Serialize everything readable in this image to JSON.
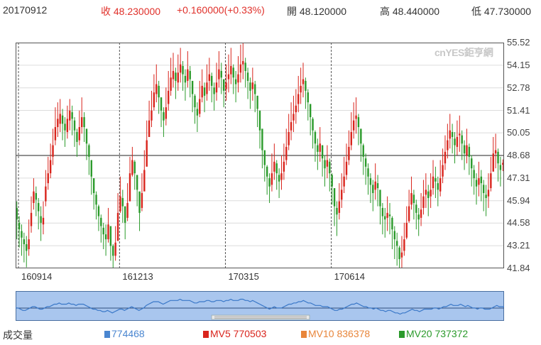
{
  "header": {
    "date": "20170912",
    "close": "收 48.230000",
    "change": "+0.160000(+0.33%)",
    "open": "開 48.120000",
    "high": "高 48.440000",
    "low": "低 47.730000"
  },
  "watermark": "cnYES鉅亨網",
  "volume_row": {
    "label": "成交量",
    "vol": "774468",
    "mv5": "MV5 770503",
    "mv10": "MV10 836378",
    "mv20": "MV20 737372"
  },
  "colors": {
    "up": "#d9241c",
    "down": "#2a9a2a",
    "accent": "#4a86d0"
  },
  "chart_data": {
    "type": "candlestick",
    "y_ticks": [
      "55.52",
      "54.15",
      "52.78",
      "51.41",
      "50.05",
      "48.68",
      "47.31",
      "45.94",
      "44.58",
      "43.21",
      "41.84"
    ],
    "ylim": [
      41.84,
      55.52
    ],
    "x_ticks": [
      "160914",
      "161213",
      "170315",
      "170614"
    ],
    "current_price_line": 48.68,
    "grid": true,
    "series": [
      {
        "close": [
          44.8,
          44.2,
          43.7,
          43.3,
          42.9,
          43.6,
          45.2,
          46.5,
          46.0,
          45.3,
          44.6,
          44.9,
          46.8,
          47.6,
          48.4,
          49.3,
          50.4,
          50.9,
          51.2,
          50.6,
          50.2,
          50.9,
          51.4,
          50.9,
          50.2,
          49.5,
          50.4,
          51.0,
          50.4,
          49.4,
          48.6,
          47.4,
          46.4,
          45.7,
          45.0,
          44.4,
          43.9,
          43.6,
          44.5,
          43.2,
          42.6,
          43.4,
          45.2,
          46.2,
          45.6,
          44.6,
          45.8,
          47.6,
          48.4,
          47.6,
          46.6,
          45.2,
          46.4,
          47.8,
          49.6,
          50.8,
          51.4,
          52.5,
          53.0,
          52.2,
          51.4,
          50.8,
          51.6,
          52.6,
          53.4,
          53.8,
          53.2,
          53.7,
          54.2,
          53.6,
          53.1,
          53.9,
          53.3,
          52.4,
          51.6,
          51.1,
          52.1,
          52.9,
          52.3,
          53.1,
          53.6,
          52.9,
          52.4,
          53.1,
          53.9,
          53.4,
          52.6,
          53.1,
          53.6,
          54.1,
          53.4,
          53.0,
          53.6,
          54.2,
          54.4,
          53.8,
          53.2,
          52.6,
          53.1,
          52.4,
          51.5,
          50.2,
          49.0,
          48.1,
          47.4,
          46.8,
          47.6,
          48.3,
          47.6,
          47.1,
          47.6,
          48.3,
          49.2,
          50.1,
          50.7,
          51.2,
          51.7,
          52.4,
          52.9,
          53.3,
          52.6,
          51.9,
          51.0,
          50.2,
          49.4,
          48.9,
          49.4,
          48.5,
          47.9,
          48.4,
          47.6,
          46.8,
          45.6,
          45.1,
          45.9,
          46.6,
          47.4,
          48.3,
          49.2,
          50.1,
          50.8,
          51.1,
          50.4,
          49.4,
          48.6,
          48.0,
          47.4,
          46.9,
          46.4,
          47.1,
          46.7,
          45.6,
          45.0,
          44.8,
          45.2,
          45.0,
          44.2,
          43.6,
          43.2,
          42.4,
          42.8,
          43.6,
          44.6,
          45.6,
          46.4,
          45.8,
          45.2,
          44.8,
          45.4,
          46.2,
          46.6,
          46.1,
          46.6,
          47.4,
          47.1,
          46.6,
          47.3,
          48.1,
          48.9,
          49.6,
          50.2,
          49.8,
          49.3,
          49.8,
          50.0,
          49.4,
          48.8,
          49.3,
          48.6,
          47.9,
          47.3,
          46.8,
          47.3,
          47.0,
          46.4,
          46.1,
          46.6,
          47.6,
          48.8,
          49.0,
          48.2,
          47.8,
          48.23
        ],
        "high": [
          45.9,
          45.0,
          44.5,
          44.0,
          43.8,
          44.8,
          46.2,
          47.3,
          46.8,
          46.1,
          45.6,
          45.9,
          47.8,
          48.6,
          49.4,
          50.3,
          51.6,
          51.9,
          52.1,
          51.5,
          51.0,
          51.7,
          52.1,
          51.7,
          51.0,
          50.3,
          51.4,
          52.2,
          51.3,
          50.2,
          49.4,
          48.2,
          47.2,
          46.5,
          45.7,
          45.1,
          44.6,
          44.5,
          45.5,
          44.0,
          43.3,
          44.4,
          46.4,
          47.4,
          46.6,
          45.4,
          47.0,
          48.6,
          49.2,
          48.4,
          47.4,
          46.0,
          47.6,
          49.0,
          50.8,
          52.0,
          52.6,
          53.6,
          54.2,
          53.2,
          52.2,
          51.6,
          52.8,
          53.8,
          54.6,
          54.9,
          54.0,
          54.8,
          55.2,
          54.4,
          53.9,
          55.0,
          54.1,
          53.2,
          52.4,
          51.9,
          53.2,
          53.9,
          53.1,
          54.2,
          54.6,
          53.7,
          53.1,
          54.3,
          55.0,
          54.3,
          53.3,
          54.2,
          54.8,
          55.2,
          54.2,
          53.8,
          54.7,
          55.4,
          55.6,
          54.6,
          54.0,
          53.4,
          54.0,
          53.2,
          52.3,
          51.0,
          49.8,
          48.9,
          48.1,
          47.6,
          48.8,
          49.4,
          48.4,
          47.9,
          48.7,
          49.4,
          50.3,
          51.2,
          51.9,
          52.3,
          52.7,
          53.5,
          54.0,
          54.3,
          53.4,
          52.7,
          51.8,
          51.0,
          50.2,
          49.7,
          50.4,
          49.3,
          48.7,
          49.3,
          48.5,
          47.6,
          46.4,
          45.9,
          47.0,
          47.6,
          48.6,
          49.4,
          50.2,
          51.3,
          51.9,
          52.2,
          51.2,
          50.2,
          49.4,
          48.8,
          48.2,
          47.6,
          47.2,
          48.2,
          47.5,
          46.4,
          45.8,
          45.5,
          46.2,
          45.8,
          45.0,
          44.4,
          44.0,
          43.2,
          43.8,
          44.6,
          45.6,
          46.6,
          47.4,
          46.6,
          46.0,
          45.5,
          46.4,
          47.2,
          47.6,
          46.9,
          47.6,
          48.4,
          48.0,
          47.4,
          48.4,
          49.1,
          49.9,
          50.6,
          51.2,
          50.6,
          50.1,
          50.8,
          51.1,
          50.2,
          49.6,
          50.3,
          49.4,
          48.7,
          48.1,
          47.6,
          48.3,
          47.8,
          47.2,
          46.9,
          47.6,
          48.6,
          49.8,
          50.0,
          49.1,
          48.6,
          48.44
        ],
        "low": [
          43.6,
          43.1,
          42.6,
          42.2,
          41.9,
          42.6,
          44.0,
          45.4,
          45.0,
          44.2,
          43.5,
          43.9,
          45.6,
          46.6,
          47.3,
          48.1,
          49.3,
          49.8,
          50.1,
          49.6,
          49.2,
          49.7,
          50.2,
          49.9,
          49.2,
          48.6,
          49.3,
          50.0,
          49.5,
          48.4,
          47.5,
          46.3,
          45.4,
          44.8,
          44.1,
          43.4,
          43.0,
          42.6,
          43.4,
          42.3,
          41.6,
          42.3,
          44.2,
          45.2,
          44.6,
          43.6,
          44.7,
          46.5,
          47.4,
          46.6,
          45.6,
          44.1,
          45.3,
          46.8,
          48.5,
          49.8,
          50.4,
          51.4,
          51.9,
          51.2,
          50.4,
          49.8,
          50.5,
          51.4,
          52.3,
          52.8,
          52.1,
          52.6,
          53.1,
          52.6,
          52.0,
          52.8,
          52.2,
          51.3,
          50.6,
          50.1,
          51.0,
          51.9,
          51.3,
          52.0,
          52.6,
          51.9,
          51.4,
          52.0,
          52.8,
          52.4,
          51.6,
          52.0,
          52.5,
          53.0,
          52.4,
          51.9,
          52.5,
          53.1,
          53.3,
          52.8,
          52.1,
          51.5,
          52.0,
          51.3,
          50.4,
          49.1,
          47.9,
          47.1,
          46.3,
          45.8,
          46.5,
          47.2,
          46.6,
          46.1,
          46.6,
          47.2,
          48.1,
          49.0,
          49.6,
          50.1,
          50.6,
          51.3,
          51.8,
          52.2,
          51.5,
          50.8,
          49.9,
          49.1,
          48.3,
          47.8,
          48.3,
          47.4,
          46.8,
          47.3,
          46.5,
          45.7,
          44.4,
          43.8,
          44.8,
          45.5,
          46.4,
          47.2,
          48.1,
          49.0,
          49.7,
          50.0,
          49.3,
          48.3,
          47.5,
          46.9,
          46.3,
          45.8,
          45.3,
          46.0,
          45.6,
          44.5,
          43.9,
          43.7,
          44.1,
          43.9,
          43.0,
          42.4,
          42.0,
          41.4,
          41.8,
          42.6,
          43.6,
          44.6,
          45.4,
          44.8,
          44.2,
          43.8,
          44.4,
          45.1,
          45.5,
          45.0,
          45.5,
          46.3,
          46.1,
          45.6,
          46.2,
          47.0,
          47.8,
          48.5,
          49.1,
          48.8,
          48.2,
          48.7,
          48.9,
          48.4,
          47.8,
          48.2,
          47.5,
          46.8,
          46.3,
          45.7,
          46.2,
          45.9,
          45.3,
          45.0,
          45.5,
          46.5,
          47.8,
          47.9,
          47.1,
          46.8,
          47.73
        ],
        "open": [
          45.5,
          44.6,
          44.1,
          43.6,
          43.3,
          43.0,
          44.4,
          45.8,
          46.4,
          45.8,
          45.0,
          44.5,
          45.9,
          47.0,
          47.6,
          48.6,
          49.6,
          50.4,
          50.6,
          51.1,
          50.6,
          50.1,
          50.8,
          51.3,
          50.8,
          50.1,
          49.6,
          50.4,
          51.0,
          50.3,
          49.3,
          48.4,
          47.3,
          46.3,
          45.6,
          44.9,
          44.3,
          43.9,
          43.6,
          44.4,
          43.2,
          42.6,
          43.5,
          45.3,
          46.1,
          45.6,
          44.9,
          45.9,
          47.5,
          48.3,
          47.5,
          46.5,
          45.5,
          46.5,
          48.0,
          49.8,
          50.8,
          51.6,
          52.4,
          52.9,
          52.2,
          51.3,
          50.9,
          51.8,
          52.6,
          53.3,
          53.7,
          53.1,
          53.7,
          54.1,
          53.5,
          53.2,
          53.8,
          53.2,
          52.3,
          51.5,
          51.2,
          52.2,
          52.8,
          52.4,
          53.2,
          53.5,
          52.8,
          52.5,
          53.3,
          53.8,
          53.3,
          52.7,
          53.3,
          53.6,
          54.0,
          53.3,
          53.1,
          53.7,
          54.2,
          54.3,
          53.7,
          53.1,
          52.7,
          53.0,
          52.3,
          51.4,
          50.3,
          49.0,
          48.0,
          47.3,
          46.9,
          47.7,
          48.2,
          47.5,
          47.2,
          47.7,
          48.4,
          49.3,
          50.2,
          50.8,
          51.3,
          51.8,
          52.5,
          53.0,
          53.2,
          52.5,
          51.8,
          50.9,
          50.1,
          49.3,
          48.9,
          49.3,
          48.4,
          48.0,
          48.3,
          47.5,
          46.7,
          45.5,
          45.2,
          46.0,
          46.8,
          47.5,
          48.4,
          49.3,
          50.2,
          50.9,
          51.0,
          50.3,
          49.3,
          48.5,
          47.9,
          47.3,
          46.9,
          46.6,
          47.0,
          46.6,
          45.5,
          45.0,
          44.9,
          45.1,
          44.9,
          44.1,
          43.5,
          43.1,
          42.5,
          42.9,
          43.7,
          44.7,
          45.7,
          46.3,
          45.7,
          45.1,
          44.9,
          45.5,
          46.3,
          46.5,
          46.2,
          46.7,
          47.3,
          47.0,
          46.5,
          47.4,
          48.2,
          49.0,
          49.7,
          50.1,
          49.7,
          49.2,
          49.9,
          49.9,
          49.3,
          48.7,
          49.2,
          48.5,
          47.8,
          47.2,
          46.9,
          47.4,
          46.9,
          46.3,
          46.2,
          46.7,
          47.7,
          48.8,
          48.9,
          48.1,
          48.12
        ]
      }
    ],
    "volume_overview": [
      47,
      47,
      46,
      45,
      45,
      46,
      47,
      48,
      48,
      47,
      46,
      46,
      47,
      48,
      48,
      49,
      50,
      50,
      51,
      50,
      50,
      50,
      51,
      50,
      50,
      49,
      50,
      50,
      50,
      49,
      48,
      47,
      46,
      46,
      45,
      45,
      44,
      44,
      45,
      44,
      43,
      44,
      45,
      46,
      46,
      45,
      46,
      47,
      48,
      47,
      46,
      45,
      46,
      47,
      49,
      50,
      51,
      52,
      52,
      52,
      51,
      50,
      51,
      52,
      53,
      53,
      53,
      53,
      54,
      53,
      53,
      53,
      53,
      52,
      51,
      51,
      52,
      52,
      52,
      53,
      53,
      52,
      52,
      53,
      53,
      53,
      52,
      53,
      53,
      54,
      53,
      53,
      53,
      54,
      54,
      53,
      53,
      52,
      53,
      52,
      51,
      50,
      49,
      48,
      47,
      46,
      47,
      48,
      47,
      47,
      47,
      48,
      49,
      50,
      50,
      51,
      51,
      52,
      52,
      53,
      52,
      51,
      51,
      50,
      49,
      49,
      49,
      48,
      48,
      48,
      47,
      46,
      45,
      45,
      46,
      46,
      47,
      48,
      49,
      50,
      50,
      51,
      50,
      49,
      48,
      48,
      47,
      47,
      46,
      47,
      46,
      45,
      45,
      44,
      45,
      45,
      44,
      43,
      43,
      42,
      43,
      43,
      44,
      45,
      46,
      45,
      45,
      44,
      45,
      46,
      46,
      46,
      46,
      47,
      47,
      46,
      47,
      48,
      48,
      49,
      50,
      49,
      49,
      49,
      50,
      49,
      48,
      49,
      48,
      47,
      47,
      46,
      47,
      47,
      46,
      46,
      46,
      47,
      48,
      49,
      48,
      48,
      48
    ]
  }
}
